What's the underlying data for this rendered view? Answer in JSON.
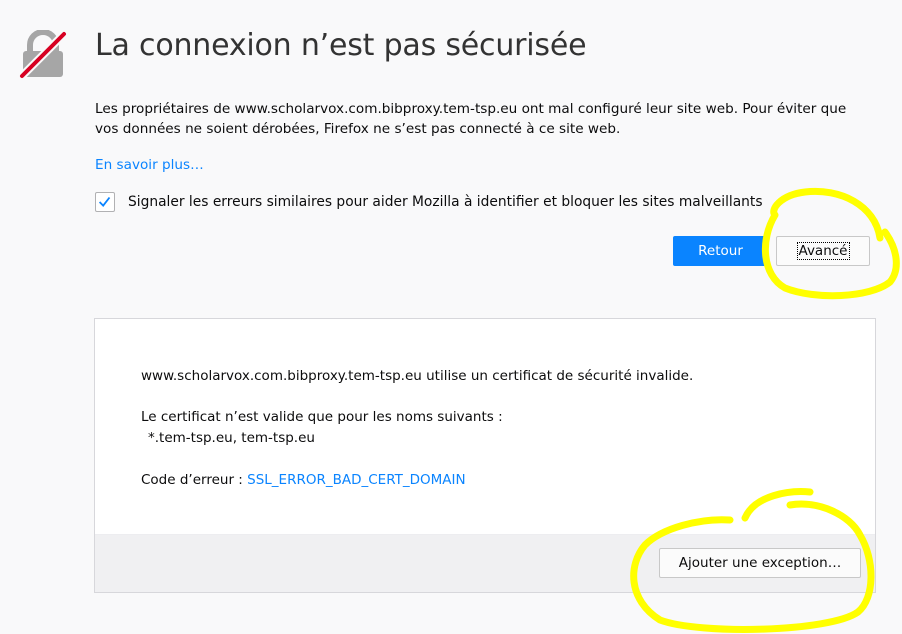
{
  "page": {
    "title": "La connexion n’est pas sécurisée",
    "description": "Les propriétaires de www.scholarvox.com.bibproxy.tem-tsp.eu ont mal configuré leur site web. Pour éviter que vos données ne soient dérobées, Firefox ne s’est pas connecté à ce site web.",
    "learn_more": "En savoir plus…",
    "report_checkbox": {
      "checked": true,
      "label": "Signaler les erreurs similaires pour aider Mozilla à identifier et bloquer les sites malveillants"
    },
    "buttons": {
      "back": "Retour",
      "advanced": "Avancé"
    }
  },
  "advanced": {
    "invalid_cert": "www.scholarvox.com.bibproxy.tem-tsp.eu utilise un certificat de sécurité invalide.",
    "valid_names_intro": "Le certificat n’est valide que pour les noms suivants :",
    "valid_names": "*.tem-tsp.eu, tem-tsp.eu",
    "error_code_label": "Code d’erreur : ",
    "error_code": "SSL_ERROR_BAD_CERT_DOMAIN",
    "add_exception": "Ajouter une exception…"
  },
  "colors": {
    "accent": "#0a84ff",
    "background": "#f9f9fa",
    "lock_strike": "#d70022",
    "annotation": "#ffff00"
  },
  "icons": [
    "broken-lock-icon",
    "checkmark-icon"
  ]
}
